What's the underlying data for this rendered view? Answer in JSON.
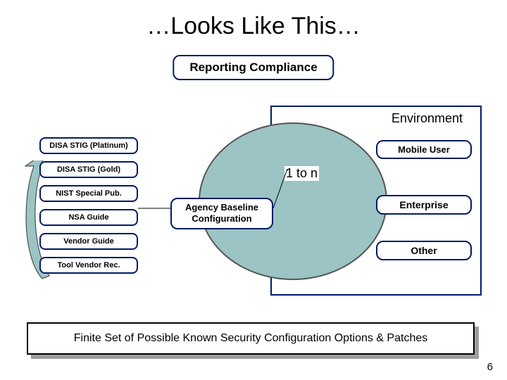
{
  "title": "…Looks Like This…",
  "compliance_label": "Reporting Compliance",
  "environment": {
    "label": "Environment",
    "one_to_n": "1 to n",
    "nodes": {
      "mobile_user": "Mobile User",
      "enterprise": "Enterprise",
      "other": "Other"
    }
  },
  "agency_line1": "Agency Baseline",
  "agency_line2": "Configuration",
  "sources": {
    "disa_platinum": "DISA STIG (Platinum)",
    "disa_gold": "DISA STIG (Gold)",
    "nist": "NIST Special Pub.",
    "nsa": "NSA Guide",
    "vendor": "Vendor Guide",
    "tool_vendor": "Tool Vendor Rec."
  },
  "footer": "Finite Set of Possible Known Security Configuration Options & Patches",
  "page_number": "6"
}
